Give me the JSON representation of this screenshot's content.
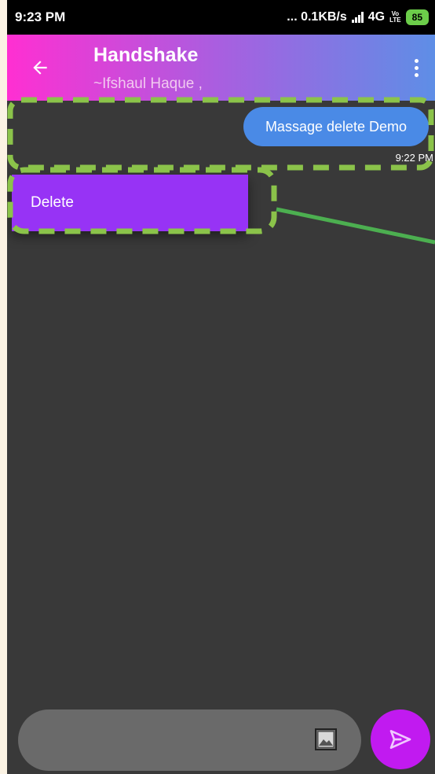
{
  "status_bar": {
    "time": "9:23 PM",
    "network_speed": "... 0.1KB/s",
    "network_type": "4G",
    "volte_top": "Vo",
    "volte_bottom": "LTE",
    "battery": "85"
  },
  "app_bar": {
    "title": "Handshake",
    "subtitle": "~Ifshaul Haque ,",
    "back_icon": "arrow-left-icon",
    "menu_icon": "more-vertical-icon"
  },
  "messages": [
    {
      "text": "Massage delete Demo",
      "time": "9:22 PM",
      "direction": "outgoing"
    }
  ],
  "context_menu": {
    "items": [
      {
        "label": "Delete"
      }
    ]
  },
  "composer": {
    "image_icon": "image-icon",
    "send_icon": "send-icon"
  },
  "colors": {
    "background": "#393939",
    "app_bar_gradient": [
      "#ff2fd2",
      "#a85fe0",
      "#5e8ee6"
    ],
    "outgoing_bubble": "#4a8ae6",
    "context_menu": "#9733f5",
    "send_button": "#c11af0",
    "input": "#6a6a6a",
    "annotation": "#8bc34a",
    "annotation_line": "#4caf50"
  }
}
